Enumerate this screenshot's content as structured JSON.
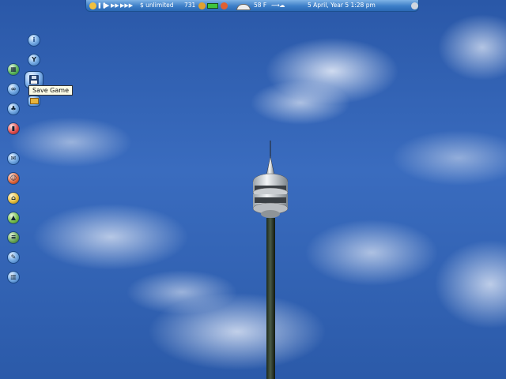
{
  "status_bar": {
    "money": "$ unlimited",
    "guests": "731",
    "temperature": "58 F",
    "date_time": "5 April, Year 5  1:28 pm",
    "speed_buttons": [
      "❚❚",
      "▶",
      "▶▶",
      "▶▶▶"
    ],
    "park_rating_color": "#3ec53e"
  },
  "tooltip": {
    "text": "Save Game"
  },
  "toolbar": {
    "left_column_icons": [
      "map-icon",
      "coaster-icon",
      "scenery-icon",
      "finance-icon",
      "park-icon",
      "staff-icon",
      "shops-icon",
      "terrain-icon",
      "path-icon",
      "build-icon",
      "trash-icon"
    ],
    "file_menu_icons": [
      "info-icon",
      "options-icon",
      "save-icon",
      "load-icon"
    ]
  },
  "colors": {
    "sky": "#2f5fae",
    "toolbar_accent": "#3c7ec8"
  }
}
